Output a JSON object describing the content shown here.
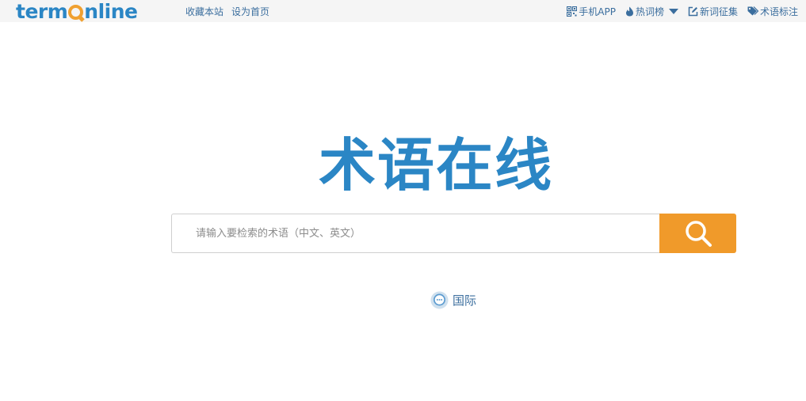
{
  "header": {
    "logo": {
      "prefix": "term",
      "suffix": "nline"
    },
    "left_links": [
      "收藏本站",
      "设为首页"
    ],
    "right_links": [
      {
        "label": "手机APP",
        "icon": "qr-code-icon"
      },
      {
        "label": "热词榜",
        "icon": "flame-icon",
        "has_dropdown": true
      },
      {
        "label": "新词征集",
        "icon": "edit-icon"
      },
      {
        "label": "术语标注",
        "icon": "tag-icon"
      }
    ]
  },
  "main": {
    "brand_title": "术语在线",
    "search": {
      "placeholder": "请输入要检索的术语（中文、英文）",
      "value": "",
      "button_icon": "search-icon"
    },
    "international_link": {
      "label": "国际",
      "icon": "chat-bubble-icon"
    }
  },
  "colors": {
    "brand_blue": "#2b86c5",
    "accent_orange": "#f09a2a",
    "link_blue": "#3b6e9e",
    "topbar_bg": "#f5f5f5"
  }
}
